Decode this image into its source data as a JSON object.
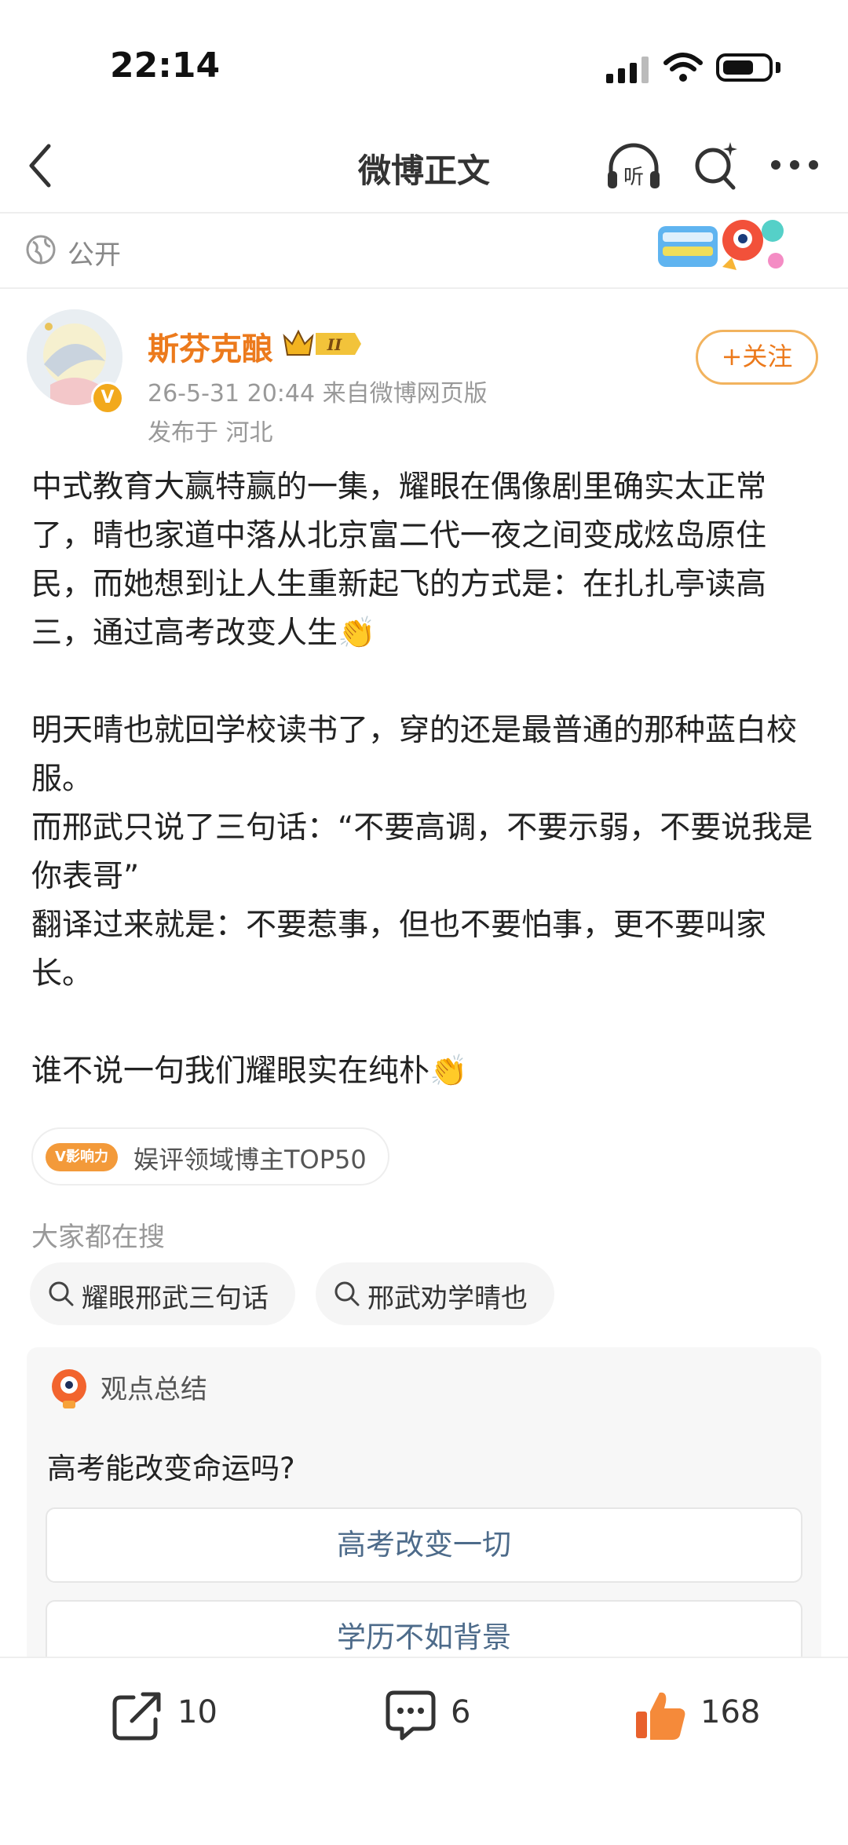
{
  "status_bar": {
    "time": "22:14"
  },
  "nav": {
    "title": "微博正文"
  },
  "post": {
    "visibility": "公开",
    "author": {
      "name": "斯芬克酿",
      "time_source": "26-5-31 20:44  来自微博网页版",
      "location": "发布于 河北",
      "follow_label": "+关注",
      "level_badge": "II"
    },
    "paragraphs": [
      "中式教育大赢特赢的一集，耀眼在偶像剧里确实太正常了，晴也家道中落从北京富二代一夜之间变成炫岛原住民，而她想到让人生重新起飞的方式是：在扎扎亭读高三，通过高考改变人生👏",
      "",
      "明天晴也就回学校读书了，穿的还是最普通的那种蓝白校服。",
      "而邢武只说了三句话：“不要高调，不要示弱，不要说我是你表哥”",
      "翻译过来就是：不要惹事，但也不要怕事，更不要叫家长。",
      "",
      "谁不说一句我们耀眼实在纯朴👏"
    ],
    "influence": {
      "badge": "V影响力",
      "text": "娱评领域博主TOP50"
    }
  },
  "hot_search": {
    "label": "大家都在搜",
    "items": [
      "耀眼邢武三句话",
      "邢武劝学晴也"
    ]
  },
  "summary": {
    "title": "观点总结",
    "question": "高考能改变命运吗?",
    "options": [
      "高考改变一切",
      "学历不如背景"
    ]
  },
  "actions": {
    "reposts": "10",
    "comments": "6",
    "likes": "168"
  },
  "colors": {
    "accent": "#ec7a1c",
    "like": "#f0792a",
    "option_text": "#4d6b8a"
  }
}
